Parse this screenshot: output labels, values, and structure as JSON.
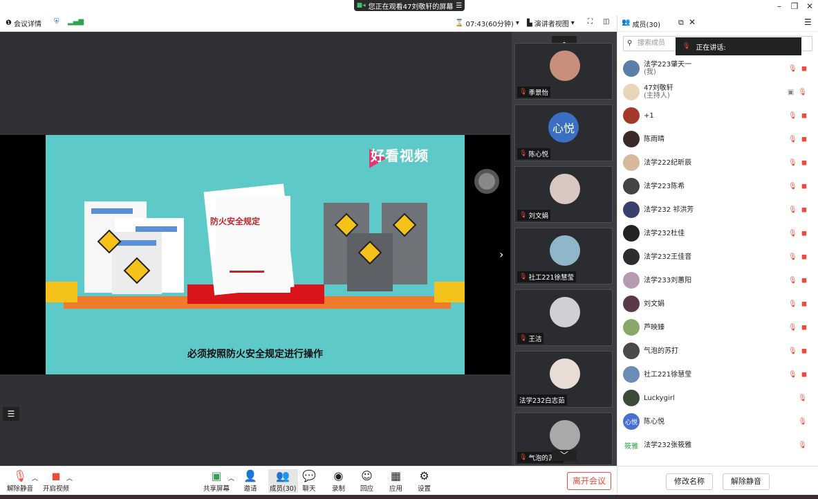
{
  "banner": {
    "text": "您正在观看47刘敬轩的屏幕"
  },
  "toolbar": {
    "meeting_info": "会议详情",
    "timer": "07:43(60分钟)",
    "view": "演讲者视图",
    "members": "成员(30)"
  },
  "video": {
    "watermark": "好看视频",
    "doc_title": "防火安全规定",
    "subtitle": "必须按照防火安全规定进行操作"
  },
  "strip": [
    {
      "name": "季景怡"
    },
    {
      "name": "陈心悦",
      "avatar_text": "心悦"
    },
    {
      "name": "刘文娟"
    },
    {
      "name": "社工221徐慧莹"
    },
    {
      "name": "王洁"
    },
    {
      "name": "法学232白志茹"
    },
    {
      "name": "气泡的苏打"
    }
  ],
  "panel": {
    "search_placeholder": "搜索成员",
    "speaking": "正在讲话:",
    "members": [
      {
        "name": "法学223肇天一",
        "sub": "(我)"
      },
      {
        "name": "47刘敬轩",
        "sub": "(主持人)"
      },
      {
        "name": "+1"
      },
      {
        "name": "陈雨晴"
      },
      {
        "name": "法学222纪昕辰"
      },
      {
        "name": "法学223陈希"
      },
      {
        "name": "法学232 祁洪芳"
      },
      {
        "name": "法学232杜佳"
      },
      {
        "name": "法学232王佳音"
      },
      {
        "name": "法学233刘蕙阳"
      },
      {
        "name": "刘文娟"
      },
      {
        "name": "芦映臻"
      },
      {
        "name": "气泡的苏打"
      },
      {
        "name": "社工221徐慧莹"
      },
      {
        "name": "Luckygirl"
      },
      {
        "name": "陈心悦",
        "avatar_text": "心悦"
      },
      {
        "name": "法学232张筱雅",
        "avatar_text": "筱雅"
      }
    ],
    "rename_button": "修改名称",
    "unmute_button": "解除静音"
  },
  "bottombar": {
    "unmute": "解除静音",
    "start_video": "开启视频",
    "share": "共享屏幕",
    "invite": "邀请",
    "members": "成员(30)",
    "chat": "聊天",
    "record": "录制",
    "react": "回应",
    "apps": "应用",
    "settings": "设置",
    "leave": "离开会议"
  },
  "colors": {
    "accent_red": "#e84c3d",
    "video_bg": "#5ec9c9",
    "stage_bg": "#2f3135"
  }
}
